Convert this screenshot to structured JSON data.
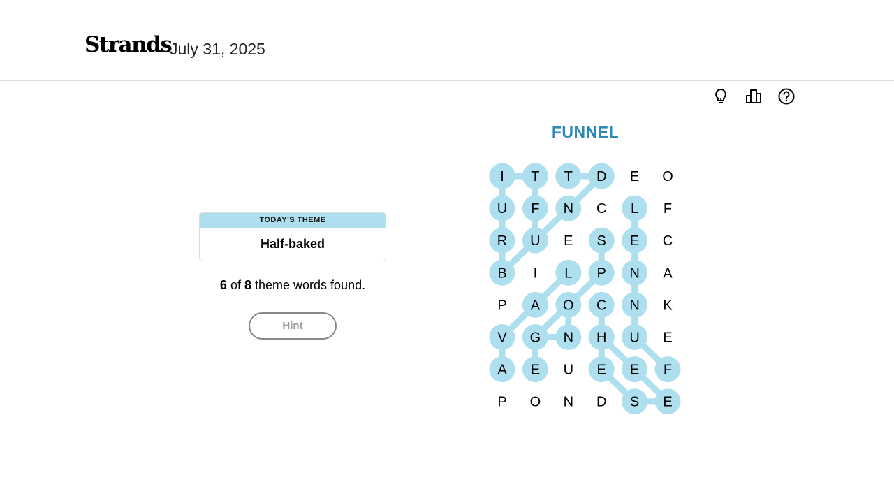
{
  "header": {
    "logo": "Strands",
    "date": "July 31, 2025"
  },
  "toolbar": {
    "icons": [
      "lightbulb-icon",
      "leaderboard-icon",
      "help-icon"
    ]
  },
  "theme": {
    "label": "TODAY'S THEME",
    "value": "Half-baked"
  },
  "progress": {
    "found": "6",
    "of": "of",
    "total": "8",
    "suffix": "theme words found."
  },
  "hint": {
    "label": "Hint",
    "enabled": false
  },
  "current_word": "FUNNEL",
  "colors": {
    "highlight": "#aedfee",
    "current_word": "#2f8ab9",
    "hint_border": "#888888"
  },
  "grid": {
    "rows": [
      [
        "I",
        "T",
        "T",
        "D",
        "E",
        "O"
      ],
      [
        "U",
        "F",
        "N",
        "C",
        "L",
        "F"
      ],
      [
        "R",
        "U",
        "E",
        "S",
        "E",
        "C"
      ],
      [
        "B",
        "I",
        "L",
        "P",
        "N",
        "A"
      ],
      [
        "P",
        "A",
        "O",
        "C",
        "N",
        "K"
      ],
      [
        "V",
        "G",
        "N",
        "H",
        "U",
        "E"
      ],
      [
        "A",
        "E",
        "U",
        "E",
        "E",
        "F"
      ],
      [
        "P",
        "O",
        "N",
        "D",
        "S",
        "E"
      ]
    ],
    "paths": [
      [
        [
          3,
          0
        ],
        [
          2,
          0
        ],
        [
          1,
          0
        ],
        [
          0,
          0
        ],
        [
          0,
          1
        ],
        [
          1,
          1
        ],
        [
          2,
          1
        ]
      ],
      [
        [
          0,
          2
        ],
        [
          0,
          3
        ],
        [
          1,
          2
        ],
        [
          2,
          1
        ],
        [
          3,
          0
        ]
      ],
      [
        [
          2,
          3
        ],
        [
          3,
          3
        ],
        [
          4,
          2
        ],
        [
          5,
          1
        ],
        [
          6,
          1
        ]
      ],
      [
        [
          3,
          2
        ],
        [
          4,
          1
        ],
        [
          5,
          0
        ],
        [
          6,
          0
        ]
      ],
      [
        [
          4,
          2
        ],
        [
          5,
          2
        ],
        [
          5,
          1
        ]
      ],
      [
        [
          4,
          3
        ],
        [
          5,
          3
        ],
        [
          6,
          4
        ],
        [
          7,
          5
        ],
        [
          7,
          4
        ]
      ],
      [
        [
          5,
          3
        ],
        [
          6,
          3
        ],
        [
          7,
          4
        ]
      ],
      [
        [
          1,
          4
        ],
        [
          2,
          4
        ],
        [
          3,
          4
        ],
        [
          4,
          4
        ],
        [
          5,
          4
        ],
        [
          6,
          5
        ]
      ]
    ]
  }
}
